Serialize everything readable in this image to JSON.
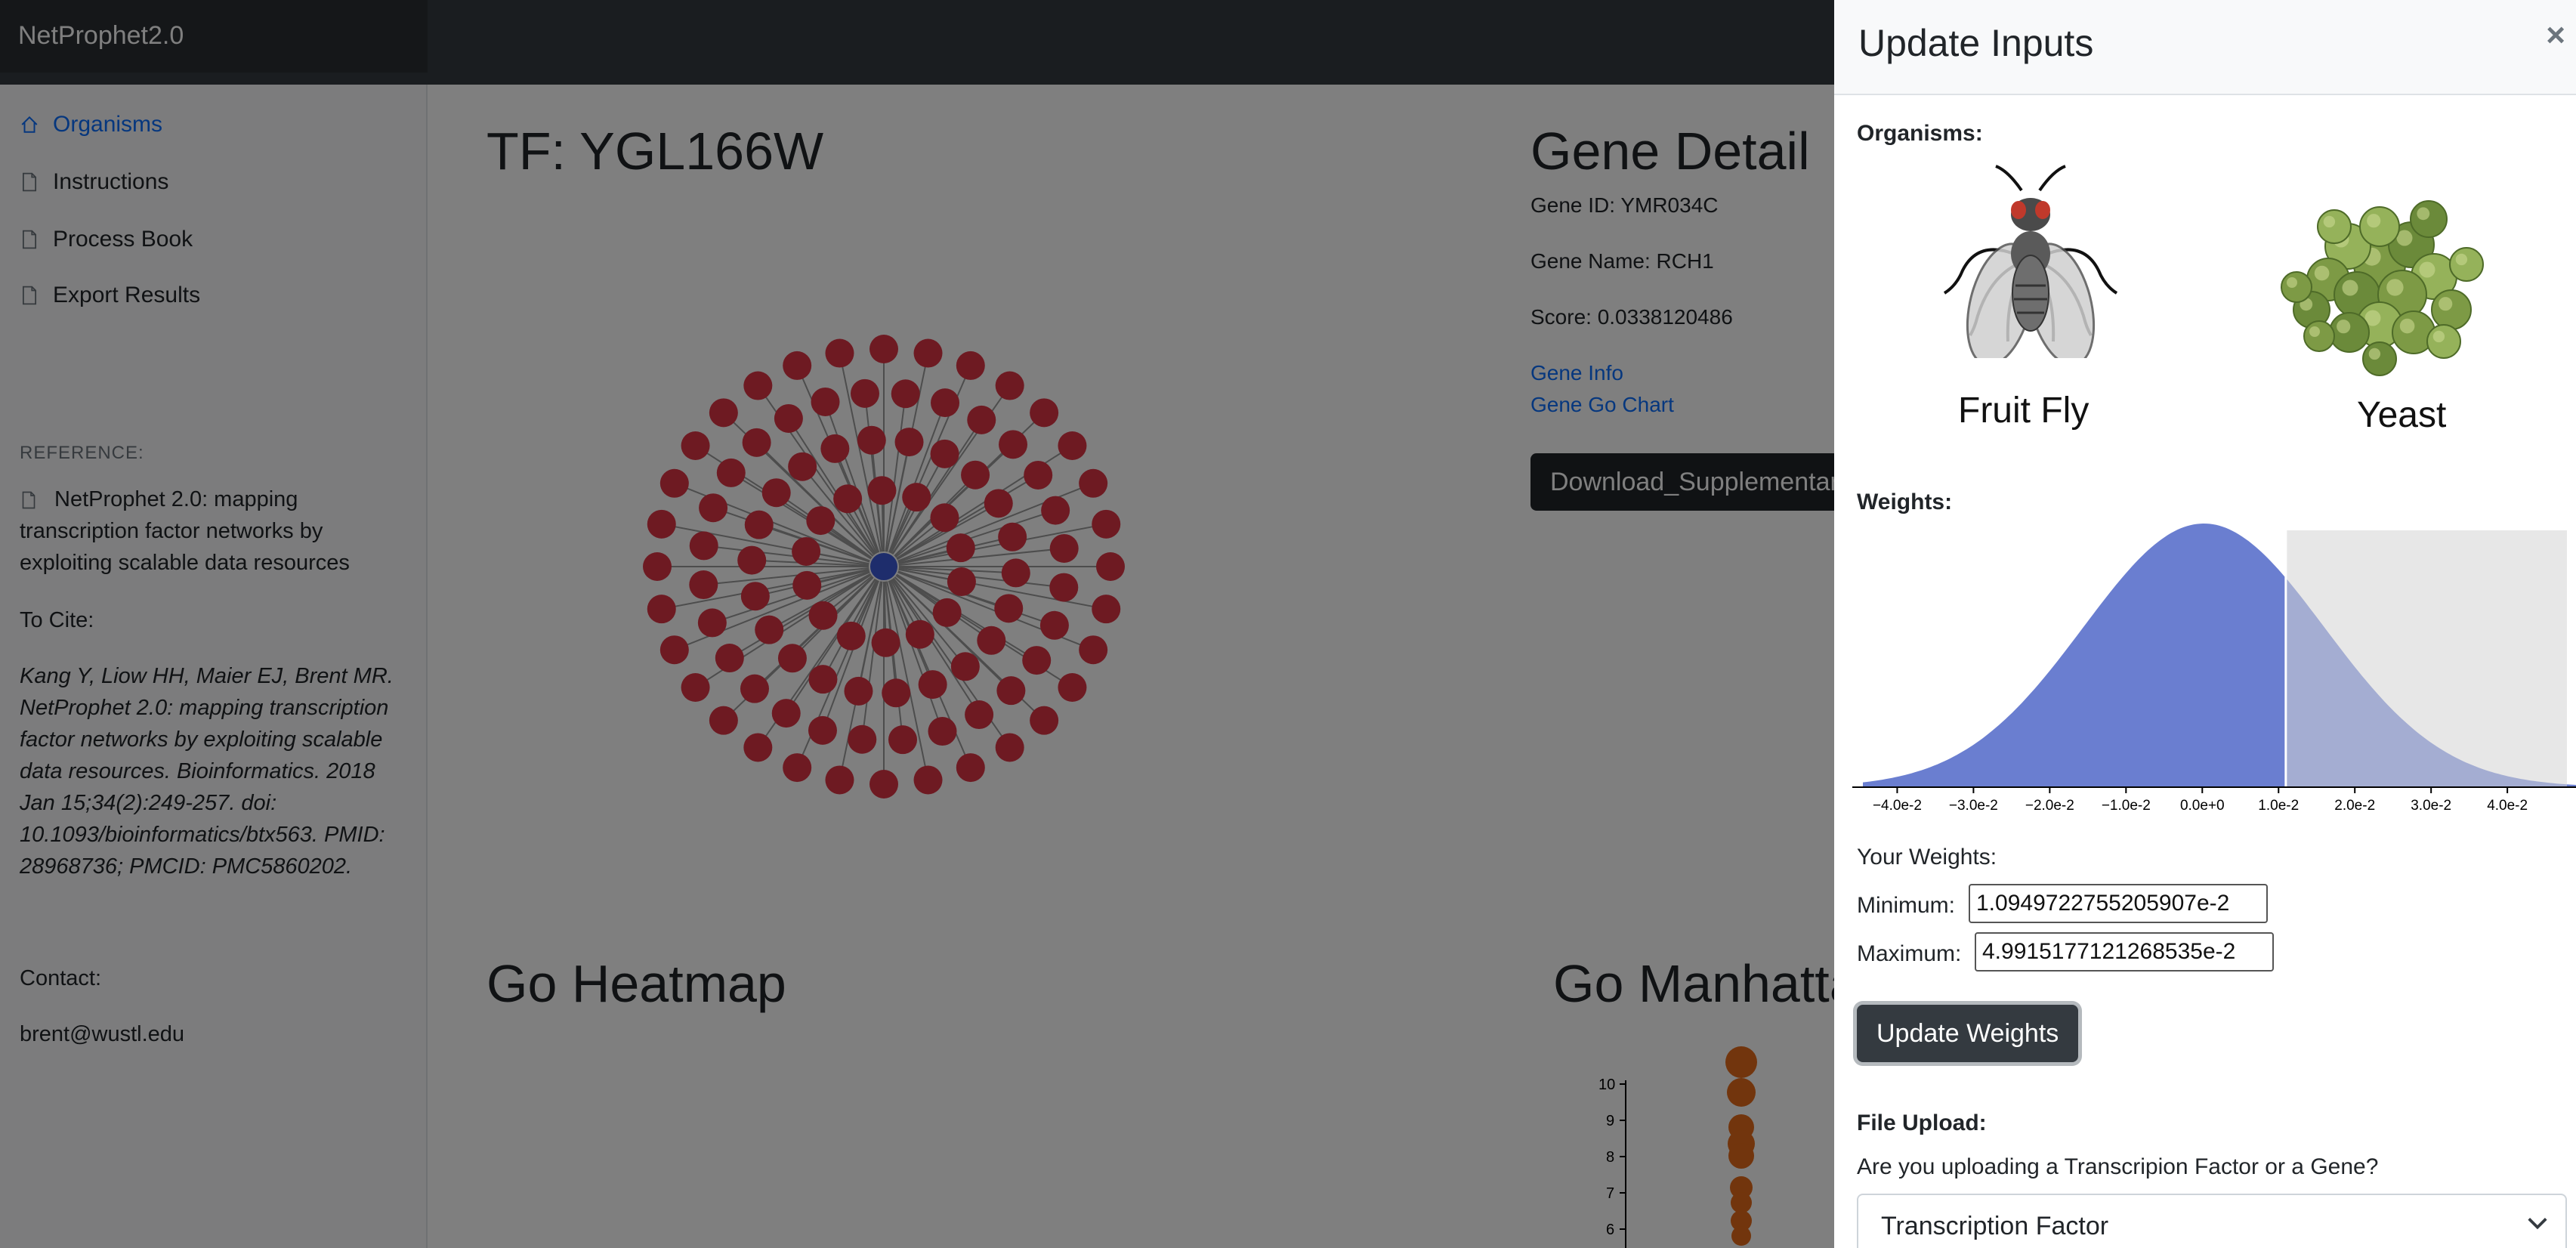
{
  "app": {
    "brand": "NetProphet2.0"
  },
  "sidebar": {
    "items": [
      {
        "label": "Organisms",
        "icon": "home-icon",
        "active": true
      },
      {
        "label": "Instructions",
        "icon": "file-icon",
        "active": false
      },
      {
        "label": "Process Book",
        "icon": "file-icon",
        "active": false
      },
      {
        "label": "Export Results",
        "icon": "file-icon",
        "active": false
      }
    ],
    "reference_label": "REFERENCE:",
    "reference_text": "NetProphet 2.0: mapping transcription factor networks by exploiting scalable data resources",
    "cite_label": "To Cite:",
    "cite_text": "Kang Y, Liow HH, Maier EJ, Brent MR. NetProphet 2.0: mapping transcription factor networks by exploiting scalable data resources. Bioinformatics. 2018 Jan 15;34(2):249-257. doi: 10.1093/bioinformatics/btx563. PMID: 28968736; PMCID: PMC5860202.",
    "contact_label": "Contact:",
    "contact_email": "brent@wustl.edu"
  },
  "main": {
    "tf_title": "TF: YGL166W",
    "gene_detail": {
      "title": "Gene Detail",
      "gene_id": "Gene ID: YMR034C",
      "gene_name": "Gene Name: RCH1",
      "score": "Score: 0.0338120486",
      "gene_info_link": "Gene Info",
      "gene_go_chart_link": "Gene Go Chart",
      "download_button": "Download_Supplementary"
    },
    "go_heatmap_title": "Go Heatmap",
    "go_manhattan_title": "Go Manhattan",
    "network": {
      "target_nodes": 96,
      "node_color": "#dc3545",
      "center_color": "#3d5bd8"
    },
    "manhattan_y_ticks": [
      "10",
      "9",
      "8",
      "7",
      "6"
    ]
  },
  "panel": {
    "title": "Update Inputs",
    "close_symbol": "×",
    "organisms_label": "Organisms:",
    "organisms": [
      {
        "name": "Fruit Fly",
        "icon": "fruit-fly-image"
      },
      {
        "name": "Yeast",
        "icon": "yeast-image"
      }
    ],
    "weights_label": "Weights:",
    "your_weights_label": "Your Weights:",
    "minimum_label": "Minimum:",
    "minimum_value": "1.0949722755205907e-2",
    "maximum_label": "Maximum:",
    "maximum_value": "4.9915177121268535e-2",
    "update_button": "Update Weights",
    "file_upload_label": "File Upload:",
    "upload_question": "Are you uploading a Transcripion Factor or a Gene?",
    "upload_select_value": "Transcription Factor"
  },
  "chart_data": {
    "type": "area",
    "x_ticks": [
      "−4.0e-2",
      "−3.0e-2",
      "−2.0e-2",
      "−1.0e-2",
      "0.0e+0",
      "1.0e-2",
      "2.0e-2",
      "3.0e-2",
      "4.0e-2"
    ],
    "x_tick_values": [
      -0.04,
      -0.03,
      -0.02,
      -0.01,
      0.0,
      0.01,
      0.02,
      0.03,
      0.04
    ],
    "xlim": [
      -0.0445,
      0.049
    ],
    "distribution": "normal",
    "mean": 0.0002,
    "sd": 0.0158,
    "selection_range": [
      0.010949722755205907,
      0.049915177121268535
    ],
    "fill_color": "#6a7ed0",
    "selection_color": "#d3d3d3"
  }
}
